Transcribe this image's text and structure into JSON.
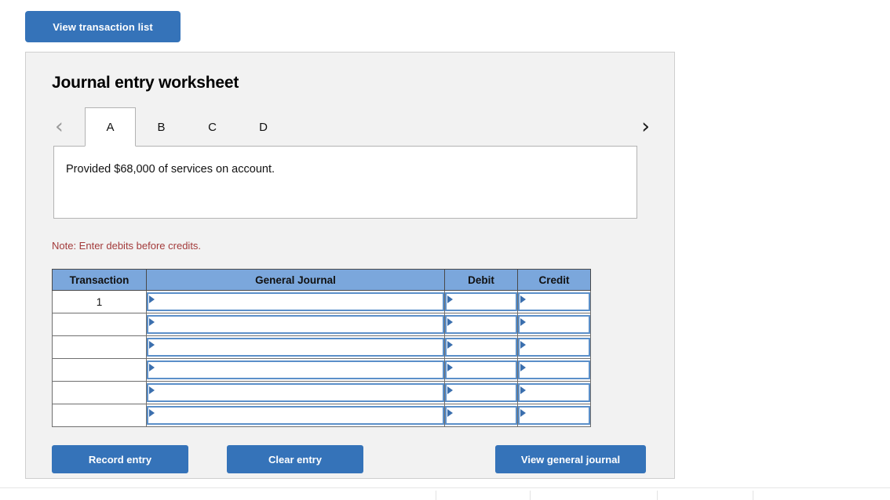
{
  "top_bar": {
    "view_transaction_list_label": "View transaction list"
  },
  "worksheet": {
    "title": "Journal entry worksheet",
    "tabs": [
      {
        "label": "A",
        "active": true
      },
      {
        "label": "B",
        "active": false
      },
      {
        "label": "C",
        "active": false
      },
      {
        "label": "D",
        "active": false
      }
    ],
    "nav": {
      "prev_icon": "chevron-left-icon",
      "prev_glyph": "‹",
      "prev_enabled": false,
      "next_icon": "chevron-right-icon",
      "next_glyph": "›",
      "next_enabled": true
    },
    "description": "Provided $68,000 of services on account.",
    "note": "Note: Enter debits before credits.",
    "table": {
      "columns": [
        "Transaction",
        "General Journal",
        "Debit",
        "Credit"
      ],
      "rows": [
        {
          "transaction": "1",
          "general_journal": "",
          "debit": "",
          "credit": ""
        },
        {
          "transaction": "",
          "general_journal": "",
          "debit": "",
          "credit": ""
        },
        {
          "transaction": "",
          "general_journal": "",
          "debit": "",
          "credit": ""
        },
        {
          "transaction": "",
          "general_journal": "",
          "debit": "",
          "credit": ""
        },
        {
          "transaction": "",
          "general_journal": "",
          "debit": "",
          "credit": ""
        },
        {
          "transaction": "",
          "general_journal": "",
          "debit": "",
          "credit": ""
        }
      ]
    },
    "actions": {
      "record_entry_label": "Record entry",
      "clear_entry_label": "Clear entry",
      "view_general_journal_label": "View general journal"
    }
  },
  "colors": {
    "button_blue": "#3573b9",
    "table_header_blue": "#7ba7dc",
    "field_border_blue": "#5b8fc9",
    "note_red": "#a33b3b",
    "panel_gray": "#f2f2f2"
  }
}
